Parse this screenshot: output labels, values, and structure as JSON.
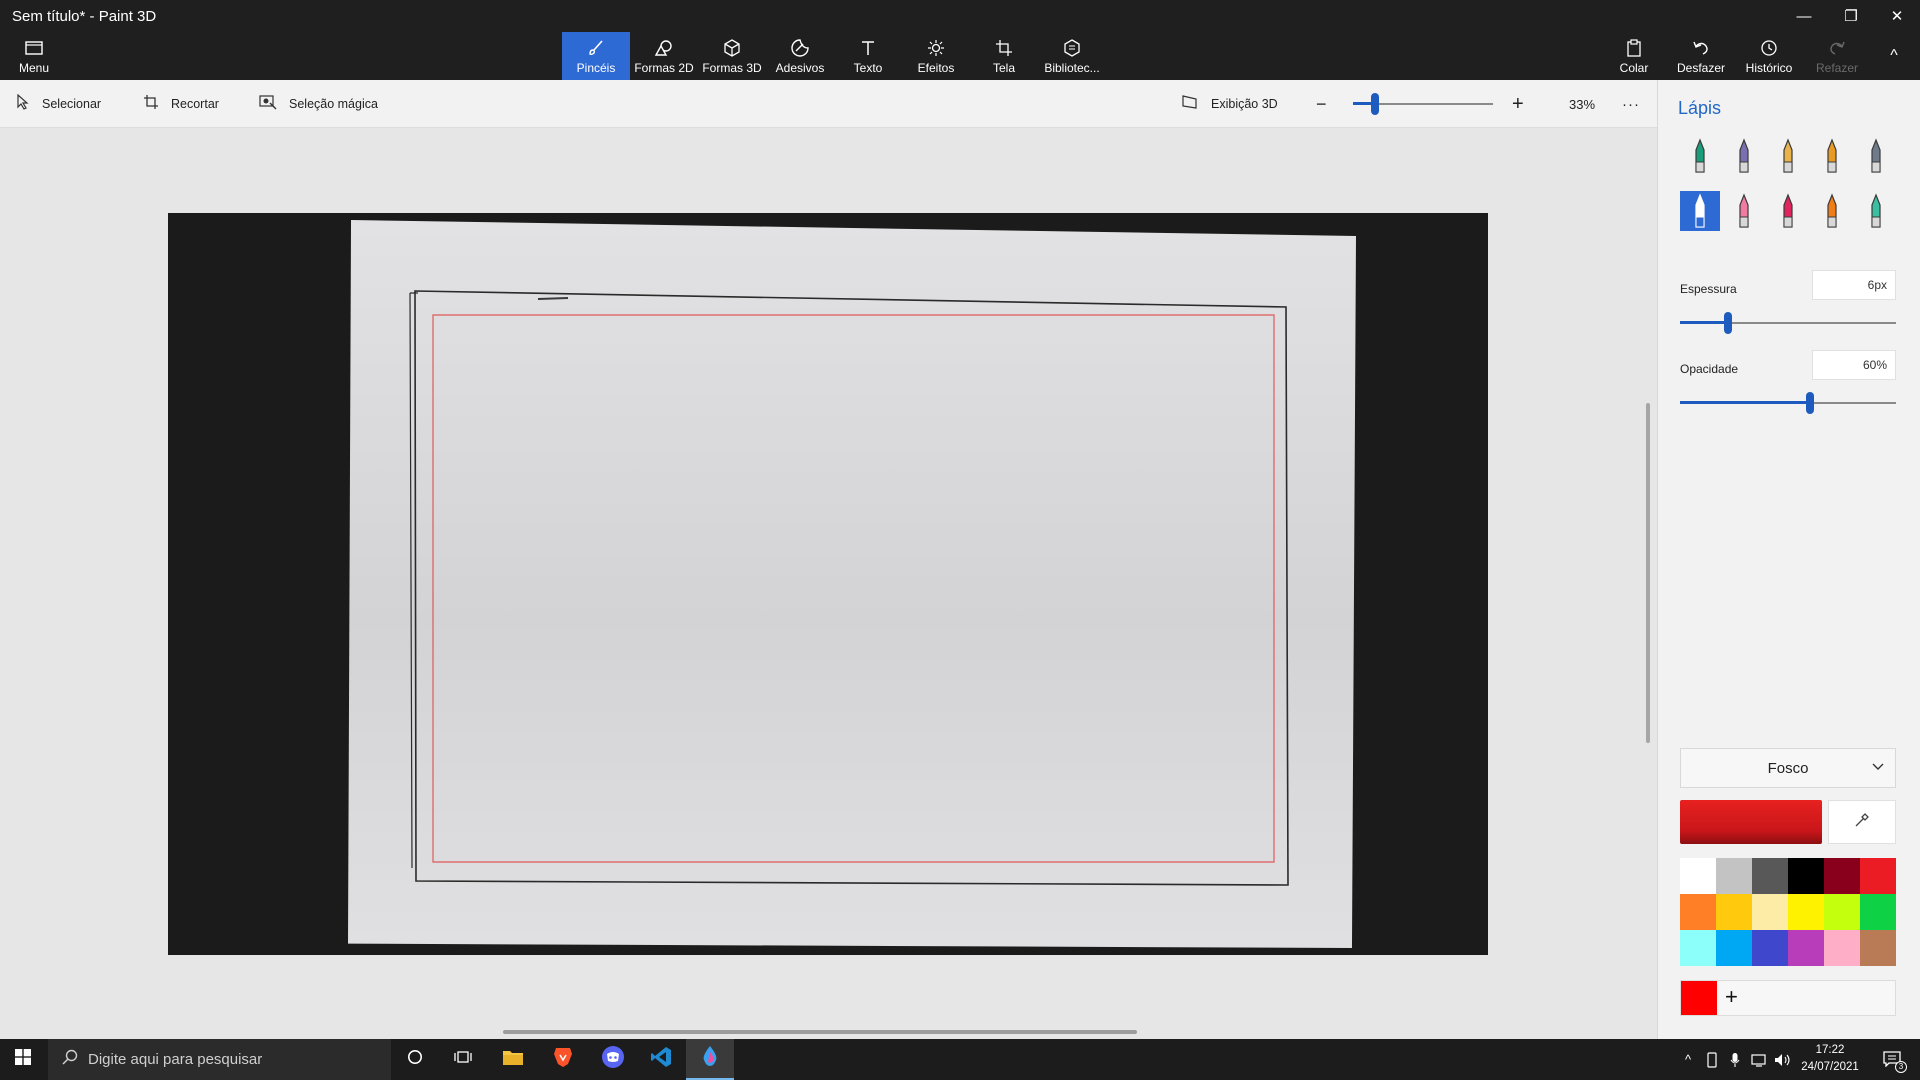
{
  "window": {
    "title": "Sem título* - Paint 3D",
    "controls": {
      "minimize": "—",
      "restore": "❐",
      "close": "✕"
    }
  },
  "ribbon": {
    "menu_label": "Menu",
    "tabs": [
      {
        "label": "Pincéis",
        "icon": "brush-icon",
        "active": true
      },
      {
        "label": "Formas 2D",
        "icon": "shapes-2d-icon"
      },
      {
        "label": "Formas 3D",
        "icon": "cube-icon"
      },
      {
        "label": "Adesivos",
        "icon": "sticker-icon"
      },
      {
        "label": "Texto",
        "icon": "text-icon"
      },
      {
        "label": "Efeitos",
        "icon": "effects-icon"
      },
      {
        "label": "Tela",
        "icon": "canvas-icon"
      },
      {
        "label": "Bibliotec...",
        "icon": "library-icon"
      }
    ],
    "right": {
      "paste": "Colar",
      "undo": "Desfazer",
      "history": "Histórico",
      "redo": "Refazer",
      "collapse": "^"
    }
  },
  "toolbar": {
    "select": "Selecionar",
    "crop": "Recortar",
    "magic_select": "Seleção mágica",
    "view_3d": "Exibição 3D",
    "zoom_out": "−",
    "zoom_in": "+",
    "zoom_level": "33%",
    "zoom_fraction": 0.16,
    "more": "···"
  },
  "panel": {
    "title": "Lápis",
    "brushes": [
      {
        "name": "marker",
        "color": "#1a9e7a",
        "selected": false
      },
      {
        "name": "calligraphy-pen",
        "color": "#7a6fb0",
        "selected": false
      },
      {
        "name": "oil-brush",
        "color": "#e9b24a",
        "selected": false
      },
      {
        "name": "watercolor",
        "color": "#e89b24",
        "selected": false
      },
      {
        "name": "pixel-pen",
        "color": "#6e7b8a",
        "selected": false
      },
      {
        "name": "pencil",
        "color": "#ffffff",
        "selected": true
      },
      {
        "name": "eraser",
        "color": "#f07aa0",
        "selected": false
      },
      {
        "name": "crayon",
        "color": "#e0245e",
        "selected": false
      },
      {
        "name": "spray-can",
        "color": "#f07d16",
        "selected": false
      },
      {
        "name": "fill",
        "color": "#3bbfa2",
        "selected": false
      }
    ],
    "thickness_label": "Espessura",
    "thickness_value": "6px",
    "thickness_fraction": 0.22,
    "opacity_label": "Opacidade",
    "opacity_value": "60%",
    "opacity_fraction": 0.6,
    "finish": "Fosco",
    "current_color": "#e8211f",
    "palette": [
      "#ffffff",
      "#c3c3c3",
      "#585858",
      "#000000",
      "#88001b",
      "#ec1c24",
      "#ff7f27",
      "#ffc90e",
      "#fdeca6",
      "#fff200",
      "#c4ff0e",
      "#0ed145",
      "#8cfffb",
      "#00a8f3",
      "#3f48cc",
      "#b83dba",
      "#ffaec8",
      "#b97a56"
    ],
    "custom_color": "#ff0000",
    "add_label": "+"
  },
  "taskbar": {
    "search_placeholder": "Digite aqui para pesquisar",
    "apps": [
      "cortana",
      "task-view",
      "file-explorer",
      "brave",
      "discord",
      "vscode",
      "paint-3d"
    ],
    "time": "17:22",
    "date": "24/07/2021",
    "notifications": "3",
    "tray_chevron": "^"
  }
}
